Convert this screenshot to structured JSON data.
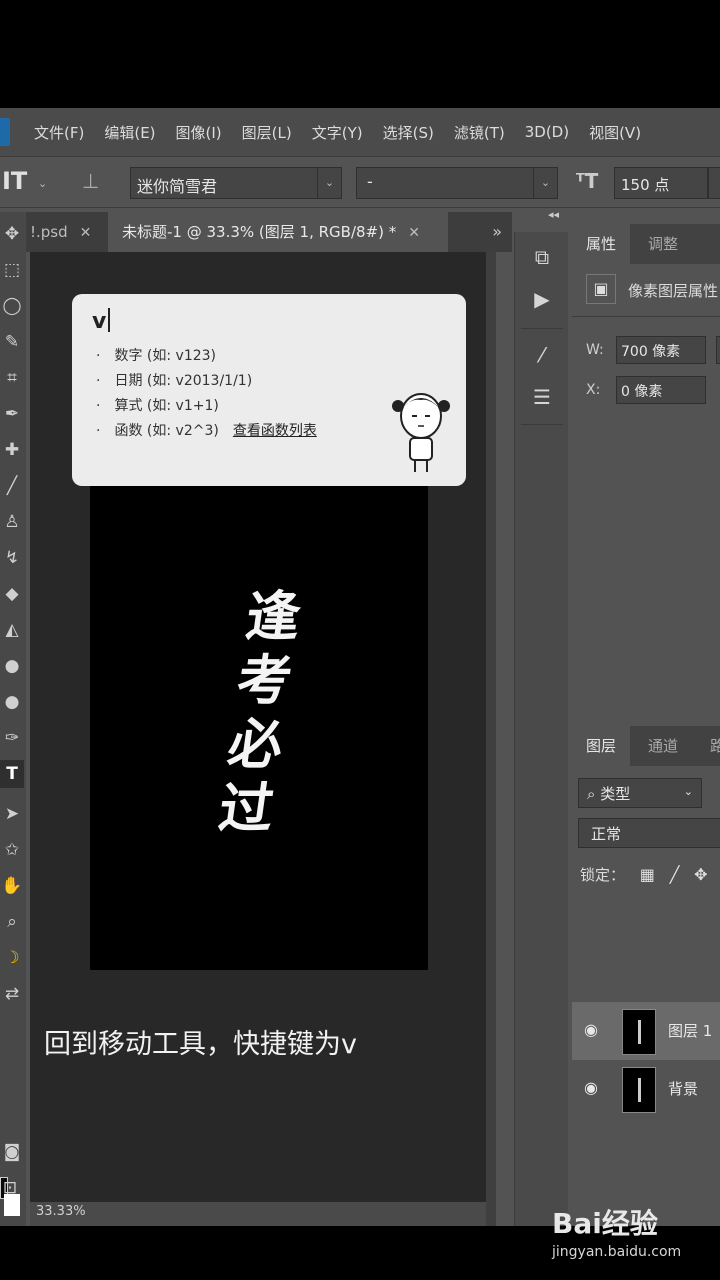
{
  "menu": [
    "文件(F)",
    "编辑(E)",
    "图像(I)",
    "图层(L)",
    "文字(Y)",
    "选择(S)",
    "滤镜(T)",
    "3D(D)",
    "视图(V)"
  ],
  "options_bar": {
    "tool_icon": "type-tool-icon",
    "font_family": "迷你简雪君",
    "font_style": "-",
    "font_size": "150 点"
  },
  "document_tabs": [
    {
      "label": "!.psd",
      "active": false
    },
    {
      "label": "未标题-1 @ 33.3% (图层 1, RGB/8#) *",
      "active": true
    }
  ],
  "canvas": {
    "calligraphy_chars": [
      "逢",
      "考",
      "必",
      "过"
    ],
    "caption": "回到移动工具，快捷键为v"
  },
  "ime_popup": {
    "input": "v",
    "hints": [
      "数字 (如: v123)",
      "日期 (如: v2013/1/1)",
      "算式 (如: v1+1)",
      "函数 (如: v2^3)"
    ],
    "link": "查看函数列表"
  },
  "status": {
    "zoom": "33.33%"
  },
  "properties_panel": {
    "tabs": [
      "属性",
      "调整"
    ],
    "layer_type": "像素图层属性",
    "w_label": "W:",
    "w_value": "700 像素",
    "x_label": "X:",
    "x_value": "0 像素"
  },
  "layers_panel": {
    "tabs": [
      "图层",
      "通道",
      "路"
    ],
    "filter": "类型",
    "blend_mode": "正常",
    "lock_label": "锁定：",
    "layers": [
      {
        "name": "图层 1",
        "selected": true
      },
      {
        "name": "背景",
        "selected": false
      }
    ]
  },
  "watermark": {
    "logo": "Bai经验",
    "url": "jingyan.baidu.com"
  },
  "colors": {
    "panel_bg": "#535353",
    "canvas_bg": "#282828",
    "popup_bg": "#ececec",
    "menubar_bg": "#4b4b4b"
  }
}
